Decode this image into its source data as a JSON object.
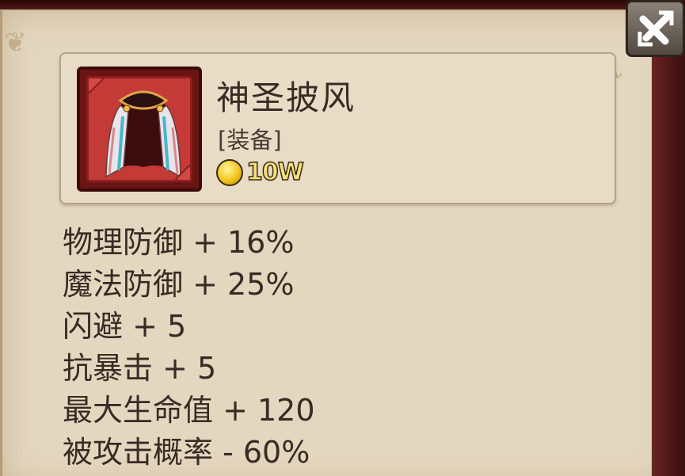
{
  "item": {
    "name": "神圣披风",
    "type": "[装备]",
    "price": "10W",
    "icon": "cloak-icon"
  },
  "stats": [
    "物理防御 + 16%",
    "魔法防御 + 25%",
    "闪避 + 5",
    "抗暴击 + 5",
    "最大生命值 + 120",
    "被攻击概率 - 60%"
  ],
  "controls": {
    "close_icon": "close-icon"
  },
  "colors": {
    "panel": "#e4d7bf",
    "frame_red": "#c43a37",
    "text": "#3a2a24",
    "coin": "#f2c41c"
  }
}
